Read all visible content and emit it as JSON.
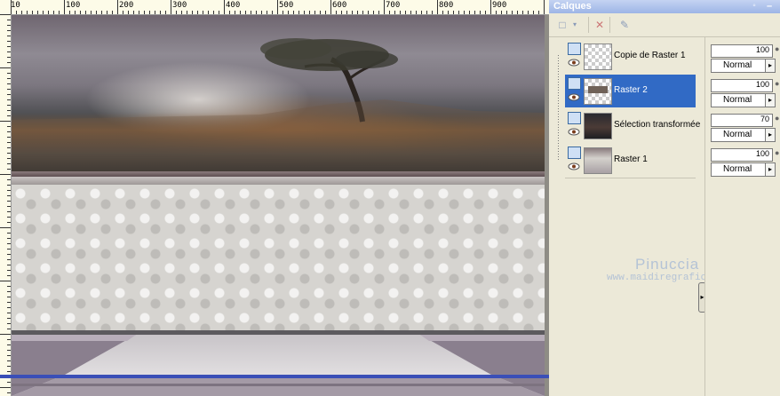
{
  "ruler": {
    "labels": [
      "10",
      "100",
      "200",
      "300",
      "400",
      "500",
      "600",
      "700",
      "800",
      "900"
    ]
  },
  "canvas": {
    "description_colors": {
      "sky": "#7c7780",
      "frame": "#5e4f52",
      "pattern": "#d6d4d0",
      "selection_bar": "#3a4fb7"
    }
  },
  "panel": {
    "title": "Calques",
    "pin_icon": "pin-icon",
    "min_label": "–",
    "toolbar": {
      "new_layer_icon": "new-layer-icon",
      "dropdown_icon": "chevron-down-icon",
      "delete_icon": "delete-layer-icon",
      "props_icon": "layer-properties-icon"
    },
    "layers": [
      {
        "name": "Copie de Raster 1",
        "selected": false,
        "opacity": "100",
        "blend": "Normal"
      },
      {
        "name": "Raster 2",
        "selected": true,
        "opacity": "100",
        "blend": "Normal"
      },
      {
        "name": "Sélection transformée",
        "selected": false,
        "opacity": "70",
        "blend": "Normal"
      },
      {
        "name": "Raster 1",
        "selected": false,
        "opacity": "100",
        "blend": "Normal"
      }
    ],
    "watermark": {
      "name": "Pinuccia",
      "url": "www.maidiregrafica.eu"
    },
    "splitter_glyph": "▸",
    "dropdown_glyph": "▸"
  }
}
